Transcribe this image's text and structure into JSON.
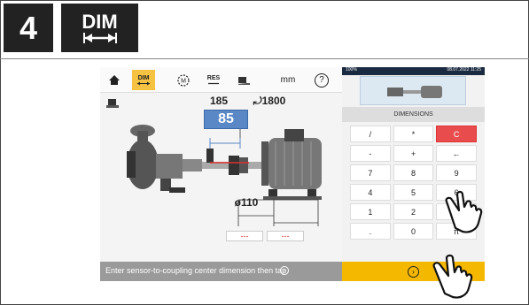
{
  "step": {
    "number": "4",
    "label": "DIM"
  },
  "toolbar": {
    "dim_label": "DIM",
    "res_label": "RES",
    "unit_label": "mm",
    "help_label": "?"
  },
  "machine": {
    "dim_top_left": "185",
    "dim_top_right": "⤾1800",
    "dim_active": "85",
    "dim_diameter": "ø110",
    "dim_foot1": "---",
    "dim_foot2": "---"
  },
  "right_panel": {
    "status_left": "100%",
    "status_right": "08.07.2022 11:25",
    "title": "DIMENSIONS"
  },
  "keypad": [
    "/",
    "*",
    "C",
    "-",
    "+",
    "←",
    "7",
    "8",
    "9",
    "4",
    "5",
    "6",
    "1",
    "2",
    "3",
    ".",
    "0",
    "π"
  ],
  "status": {
    "text": "Enter sensor-to-coupling center dimension then tap"
  },
  "colors": {
    "accent": "#f5b800",
    "active_dim": "#5a87c5",
    "clear": "#e84c4c"
  },
  "icons": [
    "home-icon",
    "measure-icon",
    "results-icon",
    "move-icon",
    "help-icon",
    "machine-icon",
    "hand-pointer-icon"
  ]
}
